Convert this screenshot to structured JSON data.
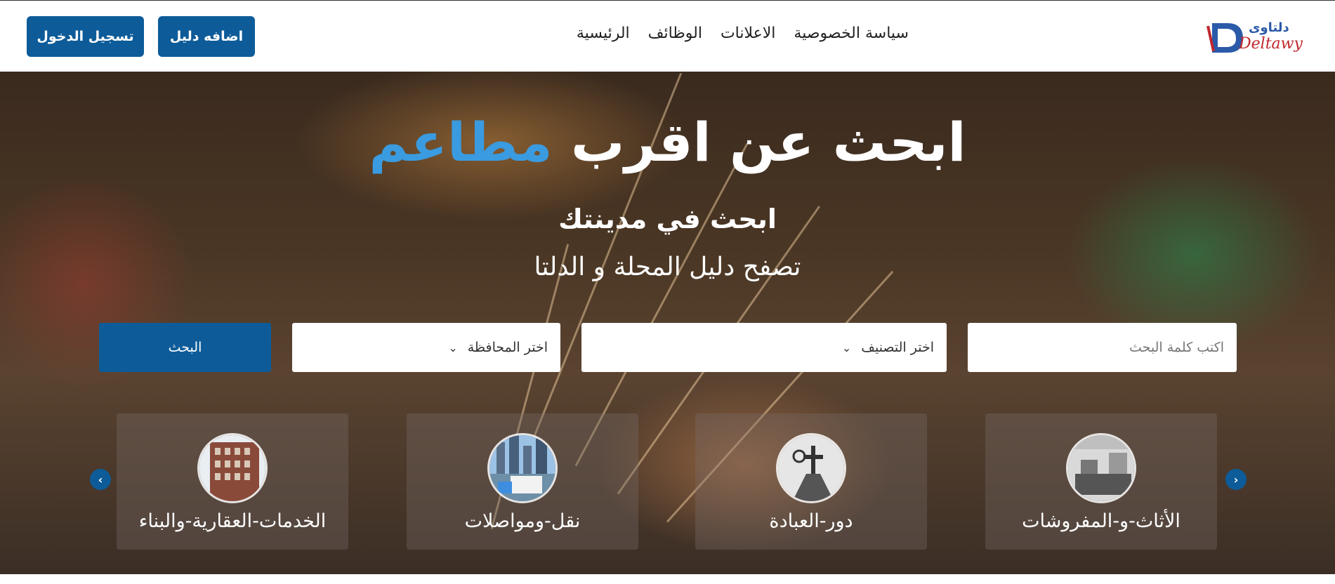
{
  "header": {
    "login_label": "تسجيل الدخول",
    "add_label": "اضافه دليل",
    "nav": [
      {
        "label": "الرئيسية"
      },
      {
        "label": "الوظائف"
      },
      {
        "label": "الاعلانات"
      },
      {
        "label": "سياسة الخصوصية"
      }
    ],
    "logo_text_ar": "دلتاوى",
    "logo_text_en": "Deltawy"
  },
  "hero": {
    "title_prefix": "ابحث عن اقرب",
    "title_accent": "مطاعم",
    "subtitle": "ابحث في مدينتك",
    "tagline": "تصفح دليل المحلة و الدلتا"
  },
  "search": {
    "keyword_placeholder": "اكتب كلمة البحث",
    "category_value": "اختر التصنيف",
    "governorate_value": "اختر المحافظة",
    "button_label": "البحث"
  },
  "categories": [
    {
      "label": "الأثاث-و-المفروشات",
      "icon": "furniture-image"
    },
    {
      "label": "دور-العبادة",
      "icon": "worship-image"
    },
    {
      "label": "نقل-ومواصلات",
      "icon": "transport-image"
    },
    {
      "label": "الخدمات-العقارية-والبناء",
      "icon": "building-image"
    }
  ],
  "colors": {
    "primary": "#0d5c99",
    "accent": "#3a9be0"
  }
}
